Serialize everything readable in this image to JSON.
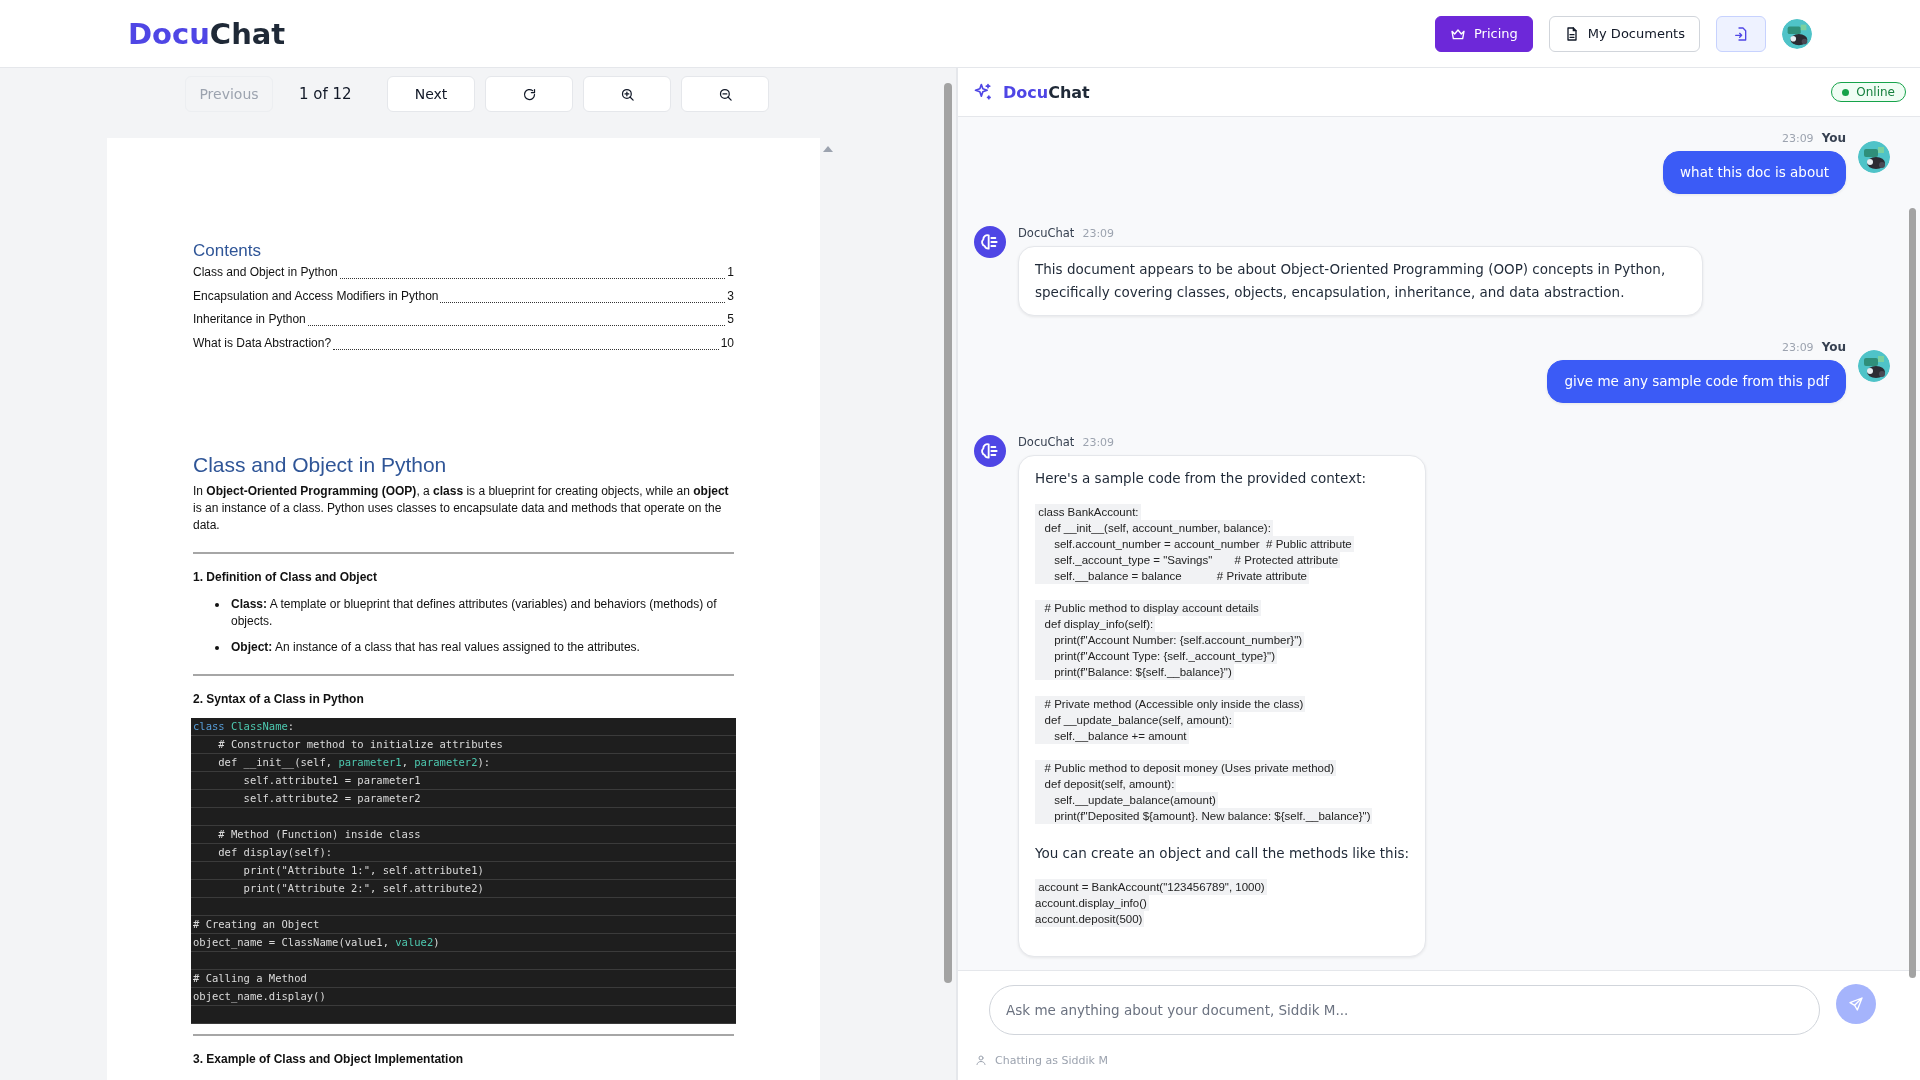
{
  "header": {
    "logo": {
      "accent": "Docu",
      "rest": "Chat"
    },
    "buttons": [
      {
        "kind": "pricing",
        "label": "Pricing"
      },
      {
        "kind": "documents",
        "label": "My Documents"
      },
      {
        "kind": "import"
      }
    ]
  },
  "viewer": {
    "previous": {
      "label": "Previous",
      "disabled": true
    },
    "page_label": "1 of 12",
    "next": {
      "label": "Next",
      "disabled": false
    },
    "tools": [
      {
        "kind": "rotate"
      },
      {
        "kind": "zoom-in"
      },
      {
        "kind": "zoom-out"
      }
    ],
    "page": {
      "contents_title": "Contents",
      "contents": [
        {
          "title": "Class and Object in Python ",
          "page": "1"
        },
        {
          "title": "Encapsulation and Access Modifiers in Python ",
          "page": "3"
        },
        {
          "title": "Inheritance in Python",
          "page": "5"
        },
        {
          "title": "What is Data Abstraction? ",
          "page": "10"
        }
      ],
      "heading": "Class and Object in Python",
      "intro": "In **Object-Oriented Programming (OOP)**, a **class** is a blueprint for creating objects, while an **object** is an instance of a class. Python uses classes to encapsulate data and methods that operate on the data.",
      "section_1": "1. Definition of Class and Object",
      "bullets": [
        "**Class:** A template or blueprint that defines attributes (variables) and behaviors (methods) of objects.",
        "**Object:** An instance of a class that has real values assigned to the attributes."
      ],
      "section_2": "2. Syntax of a Class in Python",
      "code": [
        {
          "kind": "code",
          "segments": [
            {
              "t": "class ",
              "color": "#569cd6"
            },
            {
              "t": "ClassName",
              "color": "#4ec9b0"
            },
            {
              "t": ":"
            }
          ]
        },
        {
          "kind": "code",
          "segments": [
            {
              "t": "    # Constructor method to initialize attributes",
              "color": "#dcdcdc"
            }
          ]
        },
        {
          "kind": "code",
          "segments": [
            {
              "t": "    def __init__(self, ",
              "color": "#dcdcdc"
            },
            {
              "t": "parameter1",
              "color": "#4ec9b0"
            },
            {
              "t": ", "
            },
            {
              "t": "parameter2",
              "color": "#4ec9b0"
            },
            {
              "t": "):"
            }
          ]
        },
        {
          "kind": "code",
          "segments": [
            {
              "t": "        self.attribute1 = parameter1",
              "color": "#dcdcdc"
            }
          ]
        },
        {
          "kind": "code",
          "segments": [
            {
              "t": "        self.attribute2 = parameter2",
              "color": "#dcdcdc"
            }
          ]
        },
        {
          "kind": "blank"
        },
        {
          "kind": "code",
          "segments": [
            {
              "t": "    # Method (Function) inside class",
              "color": "#dcdcdc"
            }
          ]
        },
        {
          "kind": "code",
          "segments": [
            {
              "t": "    def display(self):",
              "color": "#dcdcdc"
            }
          ]
        },
        {
          "kind": "code",
          "segments": [
            {
              "t": "        print(\"Attribute 1:\", self.attribute1)",
              "color": "#dcdcdc"
            }
          ]
        },
        {
          "kind": "code",
          "segments": [
            {
              "t": "        print(\"Attribute 2:\", self.attribute2)",
              "color": "#dcdcdc"
            }
          ]
        },
        {
          "kind": "blank"
        },
        {
          "kind": "code",
          "segments": [
            {
              "t": "# Creating an Object",
              "color": "#dcdcdc"
            }
          ]
        },
        {
          "kind": "code",
          "segments": [
            {
              "t": "object_name = ClassName(value1, ",
              "color": "#dcdcdc"
            },
            {
              "t": "value2",
              "color": "#4ec9b0"
            },
            {
              "t": ")"
            }
          ]
        },
        {
          "kind": "blank"
        },
        {
          "kind": "code",
          "segments": [
            {
              "t": "# Calling a Method",
              "color": "#dcdcdc"
            }
          ]
        },
        {
          "kind": "code",
          "segments": [
            {
              "t": "object_name.display()",
              "color": "#dcdcdc"
            }
          ]
        },
        {
          "kind": "blank"
        }
      ],
      "section_3": "3. Example of Class and Object Implementation"
    }
  },
  "chat": {
    "title": {
      "accent": "Docu",
      "rest": "Chat"
    },
    "status": "Online",
    "online": true,
    "messages": [
      {
        "kind": "user",
        "time": "23:09",
        "sender": "You",
        "blocks": [
          {
            "kind": "text",
            "text": "what this doc is about"
          }
        ]
      },
      {
        "kind": "bot",
        "sender": "DocuChat",
        "time": "23:09",
        "blocks": [
          {
            "kind": "text",
            "text": "This document appears to be about Object-Oriented Programming (OOP) concepts in Python, specifically covering classes, objects, encapsulation, inheritance, and data abstraction."
          }
        ]
      },
      {
        "kind": "user",
        "time": "23:09",
        "sender": "You",
        "blocks": [
          {
            "kind": "text",
            "text": "give me any sample code from this pdf"
          }
        ]
      },
      {
        "kind": "bot",
        "sender": "DocuChat",
        "time": "23:09",
        "blocks": [
          {
            "kind": "text",
            "text": "Here's a sample code from the provided context:"
          },
          {
            "kind": "code",
            "groups": [
              [
                " class BankAccount:",
                "   def __init__(self, account_number, balance):",
                "      self.account_number = account_number  # Public attribute",
                "      self._account_type = \"Savings\"       # Protected attribute",
                "      self.__balance = balance           # Private attribute"
              ],
              [
                "   # Public method to display account details",
                "   def display_info(self):",
                "      print(f\"Account Number: {self.account_number}\")",
                "      print(f\"Account Type: {self._account_type}\")",
                "      print(f\"Balance: ${self.__balance}\")"
              ],
              [
                "   # Private method (Accessible only inside the class)",
                "   def __update_balance(self, amount):",
                "      self.__balance += amount"
              ],
              [
                "   # Public method to deposit money (Uses private method)",
                "   def deposit(self, amount):",
                "      self.__update_balance(amount)",
                "      print(f\"Deposited ${amount}. New balance: ${self.__balance}\")"
              ]
            ]
          },
          {
            "kind": "text",
            "text": "You can create an object and call the methods like this:"
          },
          {
            "kind": "code",
            "groups": [
              [
                " account = BankAccount(\"123456789\", 1000)",
                "account.display_info()",
                "account.deposit(500)"
              ]
            ]
          }
        ]
      }
    ],
    "input": {
      "placeholder": "Ask me anything about your document, Siddik M..."
    },
    "footer": "Chatting as Siddik M"
  }
}
